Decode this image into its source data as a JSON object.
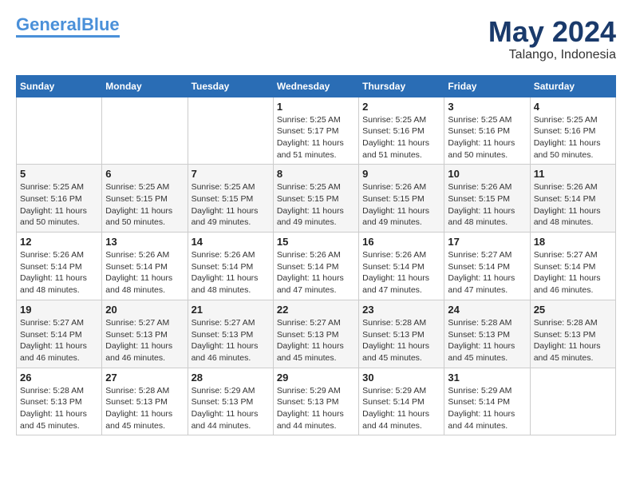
{
  "header": {
    "logo_line1": "General",
    "logo_line2": "Blue",
    "month": "May 2024",
    "location": "Talango, Indonesia"
  },
  "weekdays": [
    "Sunday",
    "Monday",
    "Tuesday",
    "Wednesday",
    "Thursday",
    "Friday",
    "Saturday"
  ],
  "weeks": [
    [
      {
        "day": "",
        "info": ""
      },
      {
        "day": "",
        "info": ""
      },
      {
        "day": "",
        "info": ""
      },
      {
        "day": "1",
        "info": "Sunrise: 5:25 AM\nSunset: 5:17 PM\nDaylight: 11 hours\nand 51 minutes."
      },
      {
        "day": "2",
        "info": "Sunrise: 5:25 AM\nSunset: 5:16 PM\nDaylight: 11 hours\nand 51 minutes."
      },
      {
        "day": "3",
        "info": "Sunrise: 5:25 AM\nSunset: 5:16 PM\nDaylight: 11 hours\nand 50 minutes."
      },
      {
        "day": "4",
        "info": "Sunrise: 5:25 AM\nSunset: 5:16 PM\nDaylight: 11 hours\nand 50 minutes."
      }
    ],
    [
      {
        "day": "5",
        "info": "Sunrise: 5:25 AM\nSunset: 5:16 PM\nDaylight: 11 hours\nand 50 minutes."
      },
      {
        "day": "6",
        "info": "Sunrise: 5:25 AM\nSunset: 5:15 PM\nDaylight: 11 hours\nand 50 minutes."
      },
      {
        "day": "7",
        "info": "Sunrise: 5:25 AM\nSunset: 5:15 PM\nDaylight: 11 hours\nand 49 minutes."
      },
      {
        "day": "8",
        "info": "Sunrise: 5:25 AM\nSunset: 5:15 PM\nDaylight: 11 hours\nand 49 minutes."
      },
      {
        "day": "9",
        "info": "Sunrise: 5:26 AM\nSunset: 5:15 PM\nDaylight: 11 hours\nand 49 minutes."
      },
      {
        "day": "10",
        "info": "Sunrise: 5:26 AM\nSunset: 5:15 PM\nDaylight: 11 hours\nand 48 minutes."
      },
      {
        "day": "11",
        "info": "Sunrise: 5:26 AM\nSunset: 5:14 PM\nDaylight: 11 hours\nand 48 minutes."
      }
    ],
    [
      {
        "day": "12",
        "info": "Sunrise: 5:26 AM\nSunset: 5:14 PM\nDaylight: 11 hours\nand 48 minutes."
      },
      {
        "day": "13",
        "info": "Sunrise: 5:26 AM\nSunset: 5:14 PM\nDaylight: 11 hours\nand 48 minutes."
      },
      {
        "day": "14",
        "info": "Sunrise: 5:26 AM\nSunset: 5:14 PM\nDaylight: 11 hours\nand 48 minutes."
      },
      {
        "day": "15",
        "info": "Sunrise: 5:26 AM\nSunset: 5:14 PM\nDaylight: 11 hours\nand 47 minutes."
      },
      {
        "day": "16",
        "info": "Sunrise: 5:26 AM\nSunset: 5:14 PM\nDaylight: 11 hours\nand 47 minutes."
      },
      {
        "day": "17",
        "info": "Sunrise: 5:27 AM\nSunset: 5:14 PM\nDaylight: 11 hours\nand 47 minutes."
      },
      {
        "day": "18",
        "info": "Sunrise: 5:27 AM\nSunset: 5:14 PM\nDaylight: 11 hours\nand 46 minutes."
      }
    ],
    [
      {
        "day": "19",
        "info": "Sunrise: 5:27 AM\nSunset: 5:14 PM\nDaylight: 11 hours\nand 46 minutes."
      },
      {
        "day": "20",
        "info": "Sunrise: 5:27 AM\nSunset: 5:13 PM\nDaylight: 11 hours\nand 46 minutes."
      },
      {
        "day": "21",
        "info": "Sunrise: 5:27 AM\nSunset: 5:13 PM\nDaylight: 11 hours\nand 46 minutes."
      },
      {
        "day": "22",
        "info": "Sunrise: 5:27 AM\nSunset: 5:13 PM\nDaylight: 11 hours\nand 45 minutes."
      },
      {
        "day": "23",
        "info": "Sunrise: 5:28 AM\nSunset: 5:13 PM\nDaylight: 11 hours\nand 45 minutes."
      },
      {
        "day": "24",
        "info": "Sunrise: 5:28 AM\nSunset: 5:13 PM\nDaylight: 11 hours\nand 45 minutes."
      },
      {
        "day": "25",
        "info": "Sunrise: 5:28 AM\nSunset: 5:13 PM\nDaylight: 11 hours\nand 45 minutes."
      }
    ],
    [
      {
        "day": "26",
        "info": "Sunrise: 5:28 AM\nSunset: 5:13 PM\nDaylight: 11 hours\nand 45 minutes."
      },
      {
        "day": "27",
        "info": "Sunrise: 5:28 AM\nSunset: 5:13 PM\nDaylight: 11 hours\nand 45 minutes."
      },
      {
        "day": "28",
        "info": "Sunrise: 5:29 AM\nSunset: 5:13 PM\nDaylight: 11 hours\nand 44 minutes."
      },
      {
        "day": "29",
        "info": "Sunrise: 5:29 AM\nSunset: 5:13 PM\nDaylight: 11 hours\nand 44 minutes."
      },
      {
        "day": "30",
        "info": "Sunrise: 5:29 AM\nSunset: 5:14 PM\nDaylight: 11 hours\nand 44 minutes."
      },
      {
        "day": "31",
        "info": "Sunrise: 5:29 AM\nSunset: 5:14 PM\nDaylight: 11 hours\nand 44 minutes."
      },
      {
        "day": "",
        "info": ""
      }
    ]
  ]
}
